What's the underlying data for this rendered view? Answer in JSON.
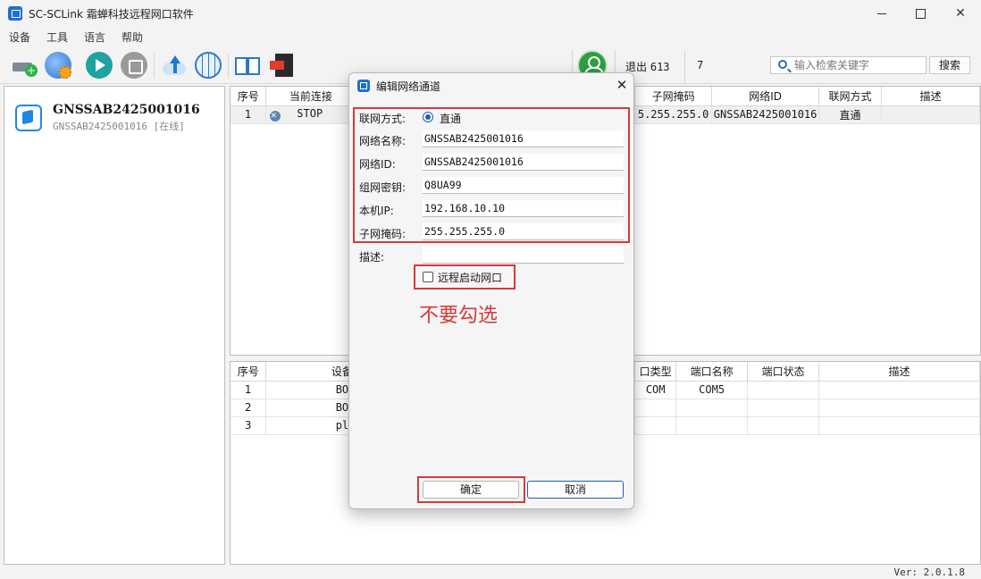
{
  "window": {
    "title": "SC-SCLink 霜蝉科技远程网口软件"
  },
  "menu": [
    "设备",
    "工具",
    "语言",
    "帮助"
  ],
  "toolbar": {
    "logout_label": "退出",
    "logout_count": "613",
    "count": "7"
  },
  "search": {
    "placeholder": "输入检索关键字",
    "button_label": "搜索"
  },
  "device": {
    "name": "GNSSAB2425001016",
    "status": "GNSSAB2425001016 [在线]"
  },
  "upper_table": {
    "headers": [
      "序号",
      "当前连接",
      "",
      "子网掩码",
      "网络ID",
      "联网方式",
      "描述"
    ],
    "rows": [
      {
        "index": "1",
        "connection": "STOP",
        "subnet": "5.255.255.0",
        "network_id": "GNSSAB2425001016",
        "mode": "直通",
        "desc": ""
      }
    ]
  },
  "lower_table": {
    "headers": [
      "序号",
      "设备",
      "",
      "口类型",
      "端口名称",
      "端口状态",
      "描述"
    ],
    "rows": [
      {
        "index": "1",
        "device": "BO",
        "port_type": "COM",
        "port_name": "COM5",
        "port_status": "",
        "desc": ""
      },
      {
        "index": "2",
        "device": "BO",
        "port_type": "",
        "port_name": "",
        "port_status": "",
        "desc": ""
      },
      {
        "index": "3",
        "device": "pl",
        "port_type": "",
        "port_name": "",
        "port_status": "",
        "desc": ""
      }
    ]
  },
  "status_bar": {
    "version": "Ver: 2.0.1.8"
  },
  "dialog": {
    "title": "编辑网络通道",
    "mode_label": "联网方式:",
    "mode_value": "直通",
    "fields": [
      {
        "label": "网络名称:",
        "value": "GNSSAB2425001016"
      },
      {
        "label": "网络ID:",
        "value": "GNSSAB2425001016"
      },
      {
        "label": "组网密钥:",
        "value": "Q8UA99"
      },
      {
        "label": "本机IP:",
        "value": "192.168.10.10"
      },
      {
        "label": "子网掩码:",
        "value": "255.255.255.0"
      },
      {
        "label": "描述:",
        "value": ""
      }
    ],
    "checkbox_label": "远程启动网口",
    "checkbox_checked": false,
    "annotation": "不要勾选",
    "ok_label": "确定",
    "cancel_label": "取消",
    "annotation_color": "#d9383a"
  }
}
